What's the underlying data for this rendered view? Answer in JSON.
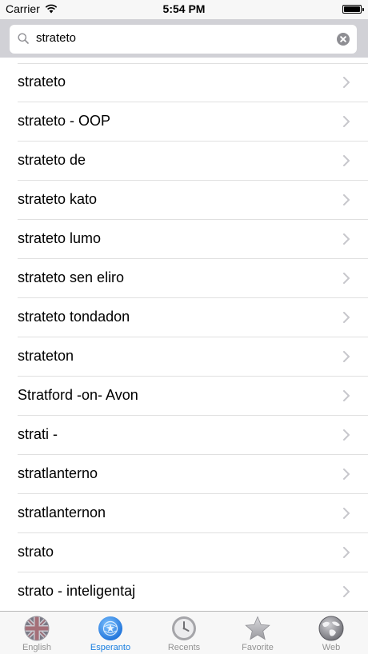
{
  "status_bar": {
    "carrier": "Carrier",
    "time": "5:54 PM",
    "wifi_icon": "wifi-icon",
    "battery_icon": "battery-icon"
  },
  "search": {
    "value": "strateto",
    "search_icon": "search-icon",
    "clear_icon": "clear-icon"
  },
  "results": [
    "strateto",
    "strateto - OOP",
    "strateto de",
    "strateto kato",
    "strateto lumo",
    "strateto sen eliro",
    "strateto tondadon",
    "strateton",
    "Stratford -on- Avon",
    "strati -",
    "stratlanterno",
    "stratlanternon",
    "strato",
    "strato - inteligentaj"
  ],
  "tab_bar": {
    "active_tab": "Esperanto",
    "active_color": "#1a7fe0",
    "inactive_color": "#929292",
    "tabs": [
      {
        "label": "English",
        "icon": "uk-flag-icon"
      },
      {
        "label": "Esperanto",
        "icon": "esperanto-flag-icon"
      },
      {
        "label": "Recents",
        "icon": "clock-icon"
      },
      {
        "label": "Favorite",
        "icon": "star-icon"
      },
      {
        "label": "Web",
        "icon": "globe-icon"
      }
    ]
  }
}
